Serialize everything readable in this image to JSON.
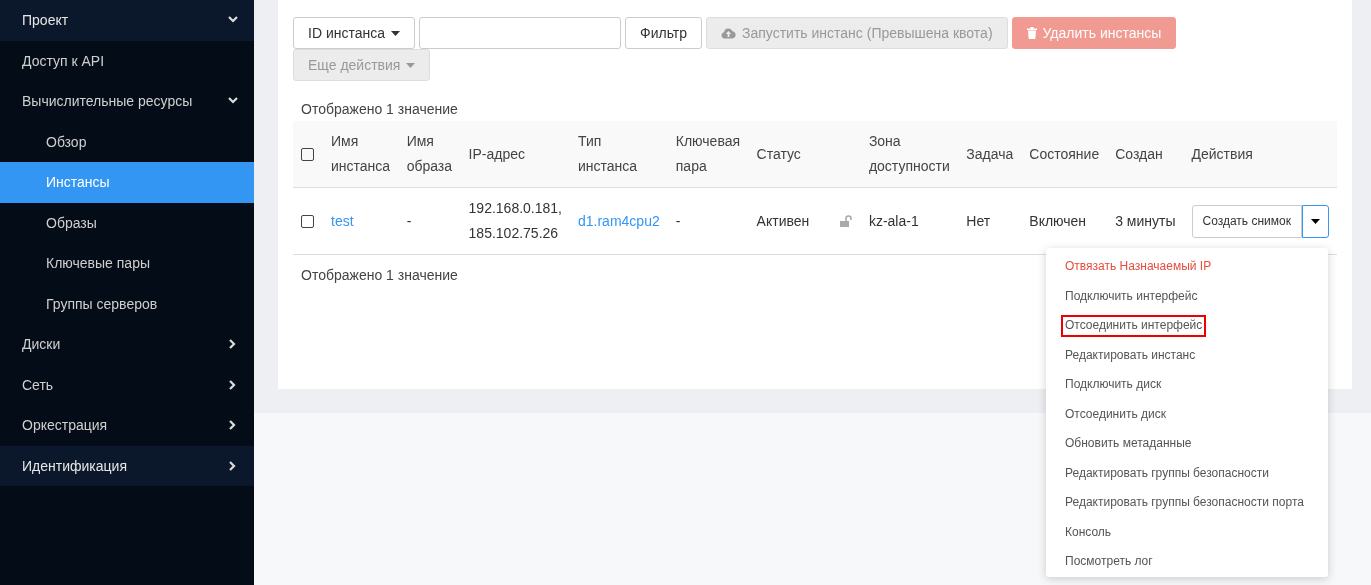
{
  "sidebar": {
    "items": [
      {
        "label": "Проект",
        "expanded": true,
        "children": [
          {
            "label": "Доступ к API",
            "selected": false
          },
          {
            "label": "Вычислительные ресурсы",
            "expanded": true,
            "children": [
              {
                "label": "Обзор",
                "selected": false
              },
              {
                "label": "Инстансы",
                "selected": true
              },
              {
                "label": "Образы",
                "selected": false
              },
              {
                "label": "Ключевые пары",
                "selected": false
              },
              {
                "label": "Группы серверов",
                "selected": false
              }
            ]
          },
          {
            "label": "Диски",
            "expanded": false
          },
          {
            "label": "Сеть",
            "expanded": false
          },
          {
            "label": "Оркестрация",
            "expanded": false
          }
        ]
      },
      {
        "label": "Идентификация",
        "expanded": false
      }
    ]
  },
  "toolbar": {
    "filter_select": "ID инстанса",
    "filter_button": "Фильтр",
    "launch_button": {
      "label": "Запустить инстанс (Превышена квота)",
      "disabled": true
    },
    "delete_button": {
      "label": "Удалить инстансы",
      "disabled": true
    },
    "more_actions": {
      "label": "Еще действия",
      "disabled": true
    }
  },
  "summary_top": "Отображено 1 значение",
  "table": {
    "select_all": {
      "checked": false
    },
    "columns": [
      "Имя инстанса",
      "Имя образа",
      "IP-адрес",
      "Тип инстанса",
      "Ключевая пара",
      "Статус",
      "Зона доступности",
      "Задача",
      "Состояние",
      "Создан",
      "Действия"
    ],
    "rows": [
      {
        "checked": false,
        "name": "test",
        "image": "-",
        "ip": [
          "192.168.0.181,",
          "185.102.75.26"
        ],
        "flavor": "d1.ram4cpu2",
        "keypair": "-",
        "status": "Активен",
        "locked": false,
        "zone": "kz-ala-1",
        "task": "Нет",
        "power": "Включен",
        "created": "3 минуты",
        "action": "Создать снимок"
      }
    ]
  },
  "summary_bottom": "Отображено 1 значение",
  "actions_menu": [
    {
      "label": "Отвязать Назначаемый IP",
      "kind": "danger",
      "highlighted": false
    },
    {
      "label": "Подключить интерфейс",
      "kind": "normal",
      "highlighted": false
    },
    {
      "label": "Отсоединить интерфейс",
      "kind": "normal",
      "highlighted": true
    },
    {
      "label": "Редактировать инстанс",
      "kind": "normal",
      "highlighted": false
    },
    {
      "label": "Подключить диск",
      "kind": "normal",
      "highlighted": false
    },
    {
      "label": "Отсоединить диск",
      "kind": "normal",
      "highlighted": false
    },
    {
      "label": "Обновить метаданные",
      "kind": "normal",
      "highlighted": false
    },
    {
      "label": "Редактировать группы безопасности",
      "kind": "normal",
      "highlighted": false
    },
    {
      "label": "Редактировать группы безопасности порта",
      "kind": "normal",
      "highlighted": false
    },
    {
      "label": "Консоль",
      "kind": "normal",
      "highlighted": false
    },
    {
      "label": "Посмотреть лог",
      "kind": "normal",
      "highlighted": false
    }
  ]
}
